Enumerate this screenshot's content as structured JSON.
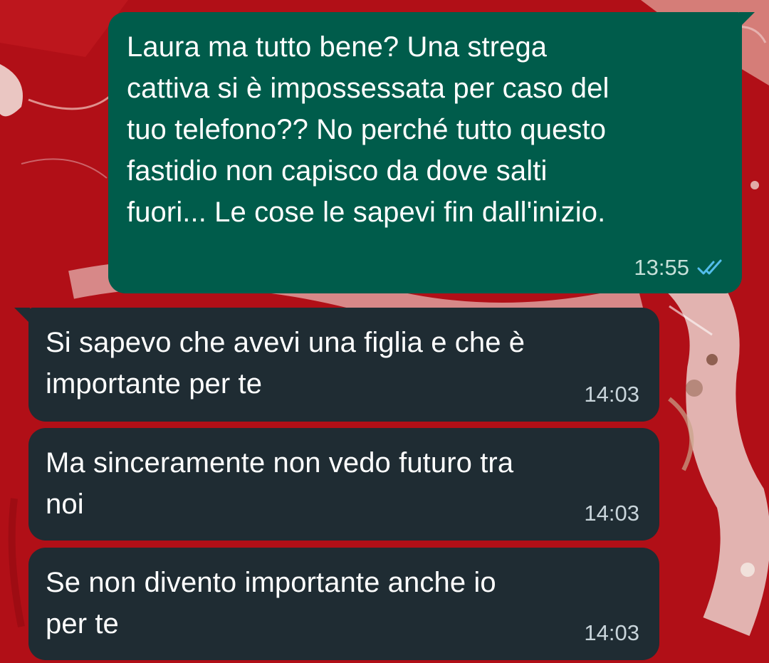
{
  "colors": {
    "wallpaper_red": "#b10f17",
    "outgoing_bubble": "#005c4b",
    "incoming_bubble": "#1f2c33",
    "read_ticks": "#53bdeb"
  },
  "messages": [
    {
      "direction": "outgoing",
      "text": "Laura ma tutto bene? Una strega\ncattiva si è impossessata per caso del\ntuo telefono?? No perché tutto questo\nfastidio non capisco da dove salti\nfuori... Le cose le sapevi fin dall'inizio.",
      "time": "13:55",
      "status_icon": "double-check-read-icon"
    },
    {
      "direction": "incoming",
      "text": "Si sapevo che avevi una figlia e che è\nimportante per te",
      "time": "14:03"
    },
    {
      "direction": "incoming",
      "text": "Ma sinceramente non vedo futuro tra\nnoi",
      "time": "14:03"
    },
    {
      "direction": "incoming",
      "text": "Se non divento importante anche io\nper te",
      "time": "14:03"
    }
  ]
}
